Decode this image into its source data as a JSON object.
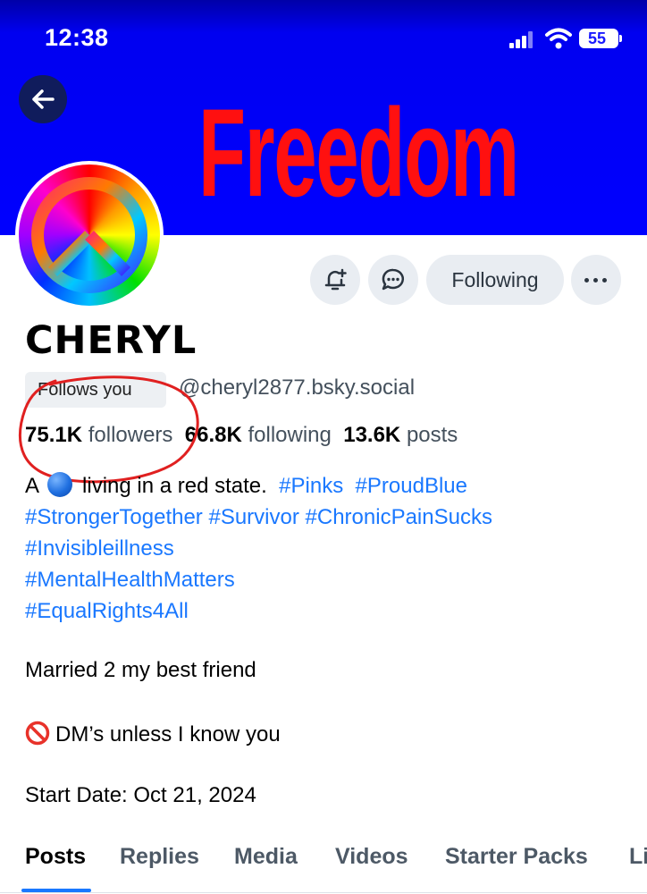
{
  "status_bar": {
    "time": "12:38",
    "battery": "55"
  },
  "banner": {
    "text": "Freedom"
  },
  "profile": {
    "display_name": "CHERYL",
    "follows_you_label": "Follows you",
    "handle": "@cheryl2877.bsky.social",
    "stats": {
      "followers_count": "75.1K",
      "followers_label": "followers",
      "following_count": "66.8K",
      "following_label": "following",
      "posts_count": "13.6K",
      "posts_label": "posts"
    }
  },
  "actions": {
    "follow_label": "Following"
  },
  "bio": {
    "line1_a": "A",
    "line1_b": "living in a red state.",
    "tags_line1": [
      "#Pinks",
      "#ProudBlue"
    ],
    "tags_line2": [
      "#StrongerTogether",
      "#Survivor",
      "#ChronicPainSucks"
    ],
    "tags_line3": [
      "#Invisibleillness"
    ],
    "tags_line4": [
      "#MentalHealthMatters"
    ],
    "tags_line5": [
      "#EqualRights4All"
    ],
    "married": "Married 2 my best friend",
    "dms": "DM’s unless I know you",
    "start_date": "Start Date: Oct 21, 2024"
  },
  "tabs": [
    "Posts",
    "Replies",
    "Media",
    "Videos",
    "Starter Packs",
    "Li"
  ],
  "active_tab": "Posts",
  "colors": {
    "banner": "#0000ff",
    "banner_text": "#ff1010",
    "link": "#1a78ff",
    "annotation": "#e02020"
  },
  "icons": [
    "back-arrow-icon",
    "signal-icon",
    "wifi-icon",
    "battery-icon",
    "bell-plus-icon",
    "chat-bubble-icon",
    "more-dots-icon",
    "peace-sign-icon",
    "blue-circle-emoji-icon",
    "prohibited-icon"
  ]
}
